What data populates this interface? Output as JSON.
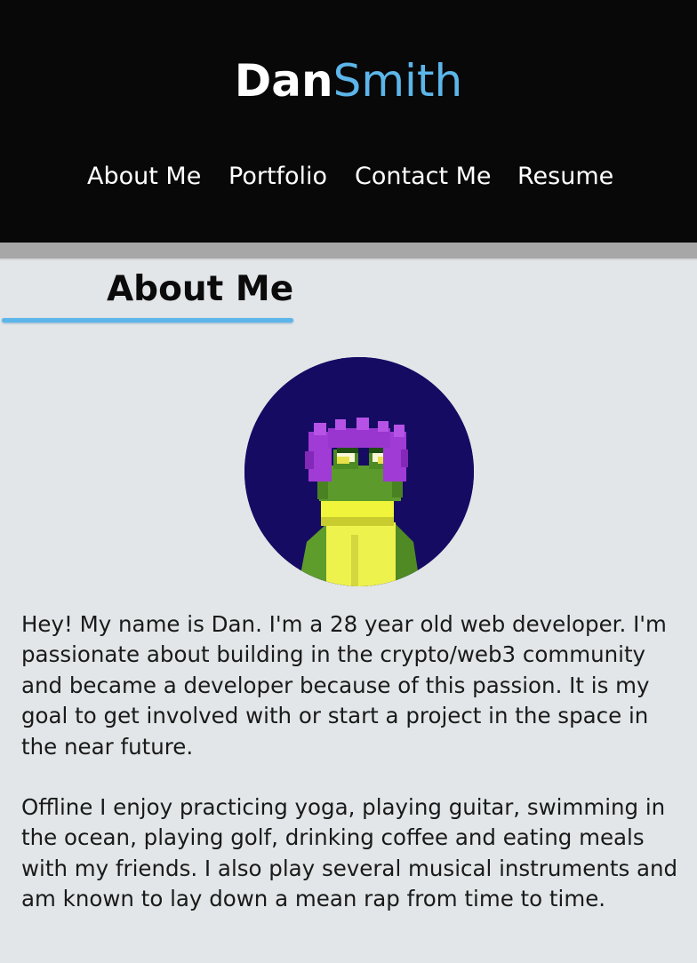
{
  "header": {
    "logo_first": "Dan",
    "logo_last": "Smith",
    "accent_color": "#5cb6ea",
    "background_color": "#080808"
  },
  "nav": {
    "items": [
      {
        "label": "About Me"
      },
      {
        "label": "Portfolio"
      },
      {
        "label": "Contact Me"
      },
      {
        "label": "Resume"
      }
    ]
  },
  "about": {
    "title": "About Me",
    "avatar_icon": "pixel-frog-avatar",
    "paragraphs": [
      "Hey! My name is Dan. I'm a 28 year old web developer. I'm passionate about building in the crypto/web3 community and became a developer because of this passion. It is my goal to get involved with or start a project in the space in the near future.",
      "Offline I enjoy practicing yoga, playing guitar, swimming in the ocean, playing golf, drinking coffee and eating meals with my friends. I also play several musical instruments and am known to lay down a mean rap from time to time."
    ]
  }
}
